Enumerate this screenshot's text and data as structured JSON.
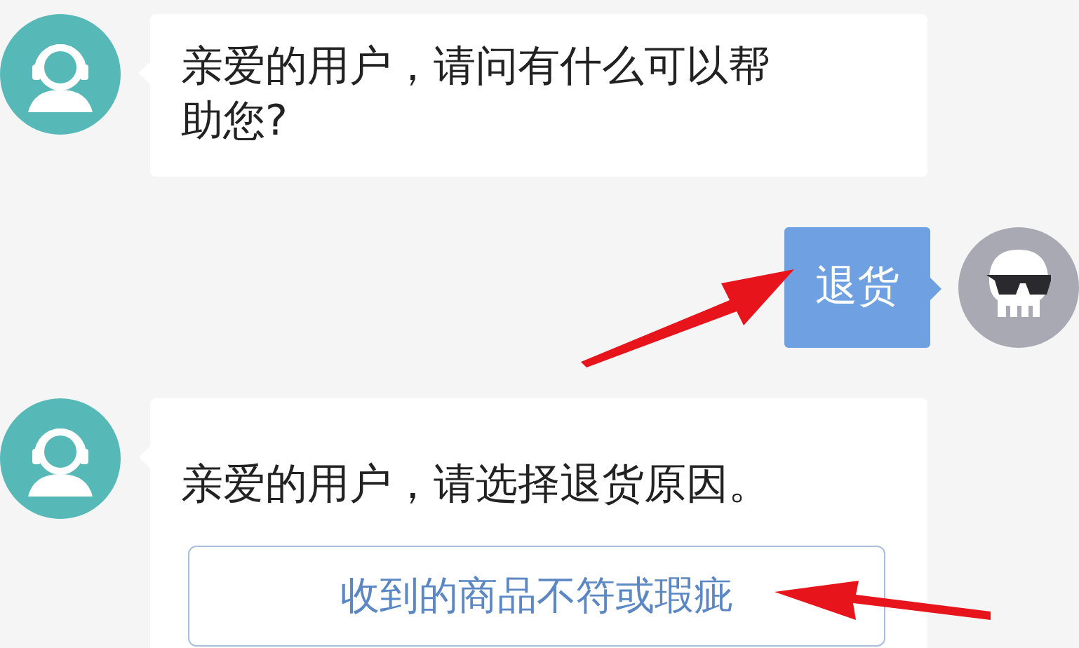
{
  "messages": [
    {
      "kind": "bot",
      "text": "亲爱的用户，请问有什么可以帮助您?"
    },
    {
      "kind": "user",
      "text": "退货"
    },
    {
      "kind": "bot",
      "text": "亲爱的用户，请选择退货原因。",
      "options": [
        "收到的商品不符或瑕疵"
      ]
    }
  ]
}
